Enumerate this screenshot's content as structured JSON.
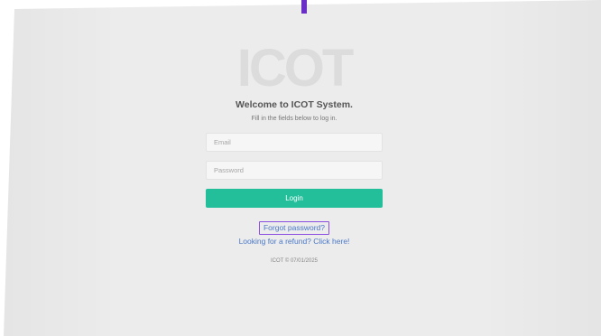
{
  "logo": {
    "text": "ICOT"
  },
  "login": {
    "welcome": "Welcome to ICOT System.",
    "subtitle": "Fill in the fields below to log in.",
    "email_placeholder": "Email",
    "password_placeholder": "Password",
    "login_label": "Login"
  },
  "links": {
    "forgot_password": "Forgot password?",
    "refund": "Looking for a refund? Click here!"
  },
  "footer": {
    "text": "ICOT © 07/01/2025"
  },
  "colors": {
    "accent_green": "#22bf9a",
    "link_blue": "#4a78c8",
    "highlight_purple": "#8a4fe0",
    "marker_purple": "#6a2fc7"
  }
}
